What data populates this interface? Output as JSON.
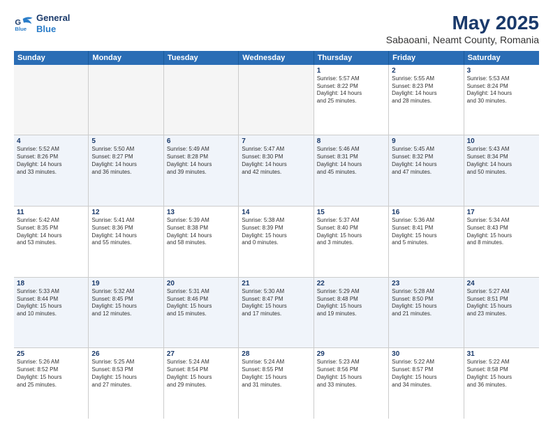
{
  "header": {
    "logo_line1": "General",
    "logo_line2": "Blue",
    "main_title": "May 2025",
    "subtitle": "Sabaoani, Neamt County, Romania"
  },
  "days_of_week": [
    "Sunday",
    "Monday",
    "Tuesday",
    "Wednesday",
    "Thursday",
    "Friday",
    "Saturday"
  ],
  "rows": [
    [
      {
        "day": "",
        "text": "",
        "empty": true
      },
      {
        "day": "",
        "text": "",
        "empty": true
      },
      {
        "day": "",
        "text": "",
        "empty": true
      },
      {
        "day": "",
        "text": "",
        "empty": true
      },
      {
        "day": "1",
        "text": "Sunrise: 5:57 AM\nSunset: 8:22 PM\nDaylight: 14 hours\nand 25 minutes."
      },
      {
        "day": "2",
        "text": "Sunrise: 5:55 AM\nSunset: 8:23 PM\nDaylight: 14 hours\nand 28 minutes."
      },
      {
        "day": "3",
        "text": "Sunrise: 5:53 AM\nSunset: 8:24 PM\nDaylight: 14 hours\nand 30 minutes."
      }
    ],
    [
      {
        "day": "4",
        "text": "Sunrise: 5:52 AM\nSunset: 8:26 PM\nDaylight: 14 hours\nand 33 minutes."
      },
      {
        "day": "5",
        "text": "Sunrise: 5:50 AM\nSunset: 8:27 PM\nDaylight: 14 hours\nand 36 minutes."
      },
      {
        "day": "6",
        "text": "Sunrise: 5:49 AM\nSunset: 8:28 PM\nDaylight: 14 hours\nand 39 minutes."
      },
      {
        "day": "7",
        "text": "Sunrise: 5:47 AM\nSunset: 8:30 PM\nDaylight: 14 hours\nand 42 minutes."
      },
      {
        "day": "8",
        "text": "Sunrise: 5:46 AM\nSunset: 8:31 PM\nDaylight: 14 hours\nand 45 minutes."
      },
      {
        "day": "9",
        "text": "Sunrise: 5:45 AM\nSunset: 8:32 PM\nDaylight: 14 hours\nand 47 minutes."
      },
      {
        "day": "10",
        "text": "Sunrise: 5:43 AM\nSunset: 8:34 PM\nDaylight: 14 hours\nand 50 minutes."
      }
    ],
    [
      {
        "day": "11",
        "text": "Sunrise: 5:42 AM\nSunset: 8:35 PM\nDaylight: 14 hours\nand 53 minutes."
      },
      {
        "day": "12",
        "text": "Sunrise: 5:41 AM\nSunset: 8:36 PM\nDaylight: 14 hours\nand 55 minutes."
      },
      {
        "day": "13",
        "text": "Sunrise: 5:39 AM\nSunset: 8:38 PM\nDaylight: 14 hours\nand 58 minutes."
      },
      {
        "day": "14",
        "text": "Sunrise: 5:38 AM\nSunset: 8:39 PM\nDaylight: 15 hours\nand 0 minutes."
      },
      {
        "day": "15",
        "text": "Sunrise: 5:37 AM\nSunset: 8:40 PM\nDaylight: 15 hours\nand 3 minutes."
      },
      {
        "day": "16",
        "text": "Sunrise: 5:36 AM\nSunset: 8:41 PM\nDaylight: 15 hours\nand 5 minutes."
      },
      {
        "day": "17",
        "text": "Sunrise: 5:34 AM\nSunset: 8:43 PM\nDaylight: 15 hours\nand 8 minutes."
      }
    ],
    [
      {
        "day": "18",
        "text": "Sunrise: 5:33 AM\nSunset: 8:44 PM\nDaylight: 15 hours\nand 10 minutes."
      },
      {
        "day": "19",
        "text": "Sunrise: 5:32 AM\nSunset: 8:45 PM\nDaylight: 15 hours\nand 12 minutes."
      },
      {
        "day": "20",
        "text": "Sunrise: 5:31 AM\nSunset: 8:46 PM\nDaylight: 15 hours\nand 15 minutes."
      },
      {
        "day": "21",
        "text": "Sunrise: 5:30 AM\nSunset: 8:47 PM\nDaylight: 15 hours\nand 17 minutes."
      },
      {
        "day": "22",
        "text": "Sunrise: 5:29 AM\nSunset: 8:48 PM\nDaylight: 15 hours\nand 19 minutes."
      },
      {
        "day": "23",
        "text": "Sunrise: 5:28 AM\nSunset: 8:50 PM\nDaylight: 15 hours\nand 21 minutes."
      },
      {
        "day": "24",
        "text": "Sunrise: 5:27 AM\nSunset: 8:51 PM\nDaylight: 15 hours\nand 23 minutes."
      }
    ],
    [
      {
        "day": "25",
        "text": "Sunrise: 5:26 AM\nSunset: 8:52 PM\nDaylight: 15 hours\nand 25 minutes."
      },
      {
        "day": "26",
        "text": "Sunrise: 5:25 AM\nSunset: 8:53 PM\nDaylight: 15 hours\nand 27 minutes."
      },
      {
        "day": "27",
        "text": "Sunrise: 5:24 AM\nSunset: 8:54 PM\nDaylight: 15 hours\nand 29 minutes."
      },
      {
        "day": "28",
        "text": "Sunrise: 5:24 AM\nSunset: 8:55 PM\nDaylight: 15 hours\nand 31 minutes."
      },
      {
        "day": "29",
        "text": "Sunrise: 5:23 AM\nSunset: 8:56 PM\nDaylight: 15 hours\nand 33 minutes."
      },
      {
        "day": "30",
        "text": "Sunrise: 5:22 AM\nSunset: 8:57 PM\nDaylight: 15 hours\nand 34 minutes."
      },
      {
        "day": "31",
        "text": "Sunrise: 5:22 AM\nSunset: 8:58 PM\nDaylight: 15 hours\nand 36 minutes."
      }
    ]
  ]
}
